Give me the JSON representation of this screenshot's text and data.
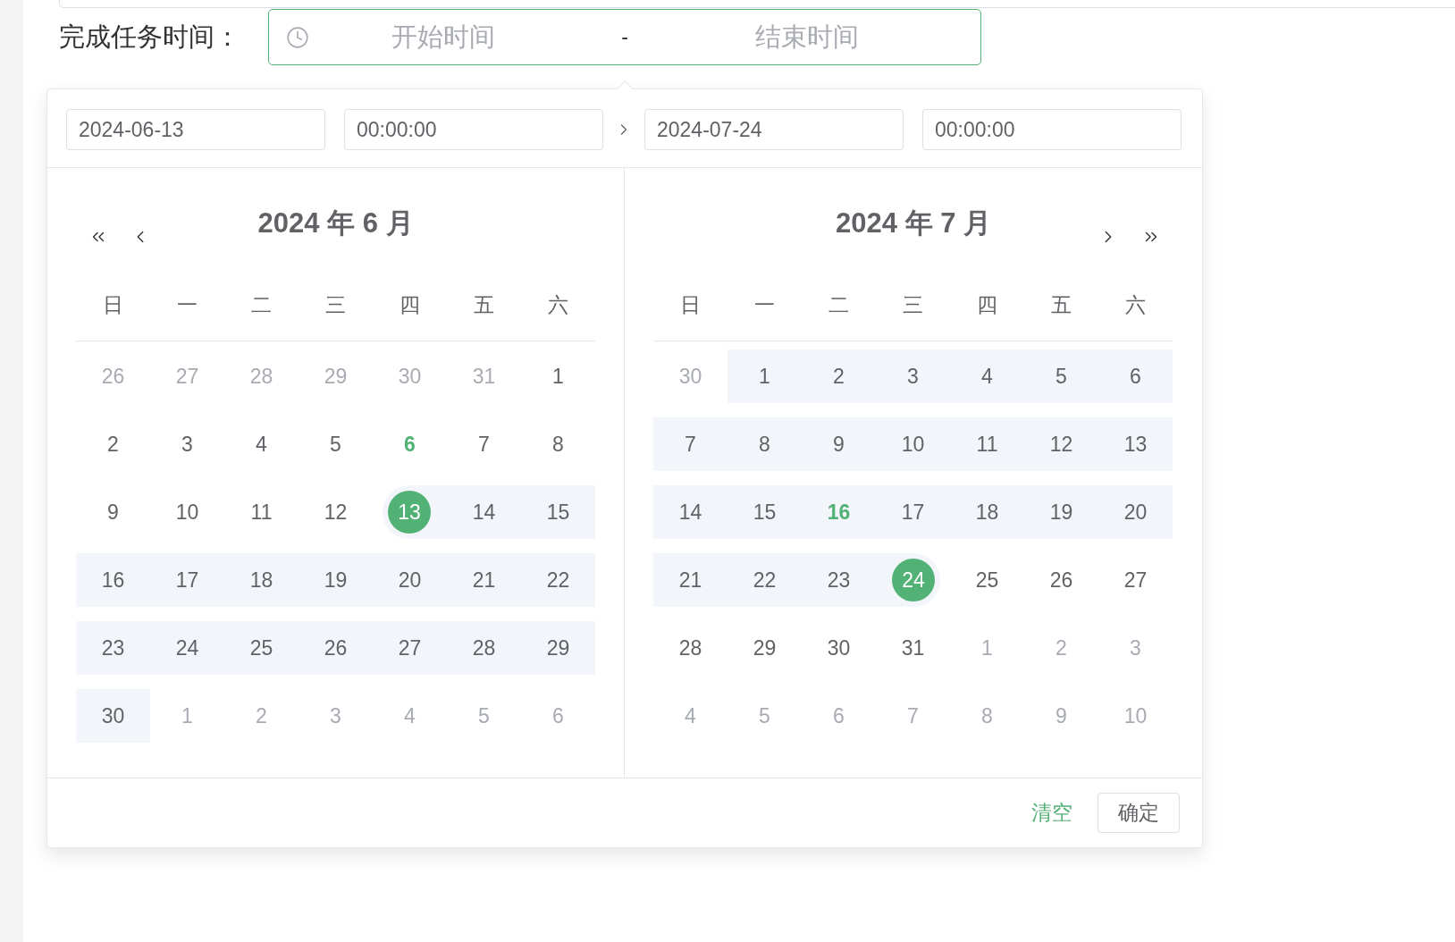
{
  "form": {
    "label": "完成任务时间：",
    "focused": true,
    "start_placeholder": "开始时间",
    "separator": "-",
    "end_placeholder": "结束时间"
  },
  "picker": {
    "start": {
      "date": "2024-06-13",
      "time": "00:00:00"
    },
    "end": {
      "date": "2024-07-24",
      "time": "00:00:00"
    },
    "panels": [
      {
        "prev_nav": true,
        "next_nav": false,
        "title": "2024 年 6 月",
        "weekdays": [
          "日",
          "一",
          "二",
          "三",
          "四",
          "五",
          "六"
        ],
        "weeks": [
          {
            "days": [
              {
                "text": "26",
                "kind": "adjacent",
                "today": false,
                "in_range": false,
                "selected": false
              },
              {
                "text": "27",
                "kind": "adjacent",
                "today": false,
                "in_range": false,
                "selected": false
              },
              {
                "text": "28",
                "kind": "adjacent",
                "today": false,
                "in_range": false,
                "selected": false
              },
              {
                "text": "29",
                "kind": "adjacent",
                "today": false,
                "in_range": false,
                "selected": false
              },
              {
                "text": "30",
                "kind": "adjacent",
                "today": false,
                "in_range": false,
                "selected": false
              },
              {
                "text": "31",
                "kind": "adjacent",
                "today": false,
                "in_range": false,
                "selected": false
              },
              {
                "text": "1",
                "kind": "current",
                "today": false,
                "in_range": false,
                "selected": false
              }
            ]
          },
          {
            "days": [
              {
                "text": "2",
                "kind": "current",
                "today": false,
                "in_range": false,
                "selected": false
              },
              {
                "text": "3",
                "kind": "current",
                "today": false,
                "in_range": false,
                "selected": false
              },
              {
                "text": "4",
                "kind": "current",
                "today": false,
                "in_range": false,
                "selected": false
              },
              {
                "text": "5",
                "kind": "current",
                "today": false,
                "in_range": false,
                "selected": false
              },
              {
                "text": "6",
                "kind": "current",
                "today": true,
                "in_range": false,
                "selected": false
              },
              {
                "text": "7",
                "kind": "current",
                "today": false,
                "in_range": false,
                "selected": false
              },
              {
                "text": "8",
                "kind": "current",
                "today": false,
                "in_range": false,
                "selected": false
              }
            ]
          },
          {
            "days": [
              {
                "text": "9",
                "kind": "current",
                "today": false,
                "in_range": false,
                "selected": false
              },
              {
                "text": "10",
                "kind": "current",
                "today": false,
                "in_range": false,
                "selected": false
              },
              {
                "text": "11",
                "kind": "current",
                "today": false,
                "in_range": false,
                "selected": false
              },
              {
                "text": "12",
                "kind": "current",
                "today": false,
                "in_range": false,
                "selected": false
              },
              {
                "text": "13",
                "kind": "current",
                "today": false,
                "in_range": true,
                "selected": true
              },
              {
                "text": "14",
                "kind": "current",
                "today": false,
                "in_range": true,
                "selected": false
              },
              {
                "text": "15",
                "kind": "current",
                "today": false,
                "in_range": true,
                "selected": false
              }
            ]
          },
          {
            "days": [
              {
                "text": "16",
                "kind": "current",
                "today": false,
                "in_range": true,
                "selected": false
              },
              {
                "text": "17",
                "kind": "current",
                "today": false,
                "in_range": true,
                "selected": false
              },
              {
                "text": "18",
                "kind": "current",
                "today": false,
                "in_range": true,
                "selected": false
              },
              {
                "text": "19",
                "kind": "current",
                "today": false,
                "in_range": true,
                "selected": false
              },
              {
                "text": "20",
                "kind": "current",
                "today": false,
                "in_range": true,
                "selected": false
              },
              {
                "text": "21",
                "kind": "current",
                "today": false,
                "in_range": true,
                "selected": false
              },
              {
                "text": "22",
                "kind": "current",
                "today": false,
                "in_range": true,
                "selected": false
              }
            ]
          },
          {
            "days": [
              {
                "text": "23",
                "kind": "current",
                "today": false,
                "in_range": true,
                "selected": false
              },
              {
                "text": "24",
                "kind": "current",
                "today": false,
                "in_range": true,
                "selected": false
              },
              {
                "text": "25",
                "kind": "current",
                "today": false,
                "in_range": true,
                "selected": false
              },
              {
                "text": "26",
                "kind": "current",
                "today": false,
                "in_range": true,
                "selected": false
              },
              {
                "text": "27",
                "kind": "current",
                "today": false,
                "in_range": true,
                "selected": false
              },
              {
                "text": "28",
                "kind": "current",
                "today": false,
                "in_range": true,
                "selected": false
              },
              {
                "text": "29",
                "kind": "current",
                "today": false,
                "in_range": true,
                "selected": false
              }
            ]
          },
          {
            "days": [
              {
                "text": "30",
                "kind": "current",
                "today": false,
                "in_range": true,
                "selected": false
              },
              {
                "text": "1",
                "kind": "adjacent",
                "today": false,
                "in_range": false,
                "selected": false
              },
              {
                "text": "2",
                "kind": "adjacent",
                "today": false,
                "in_range": false,
                "selected": false
              },
              {
                "text": "3",
                "kind": "adjacent",
                "today": false,
                "in_range": false,
                "selected": false
              },
              {
                "text": "4",
                "kind": "adjacent",
                "today": false,
                "in_range": false,
                "selected": false
              },
              {
                "text": "5",
                "kind": "adjacent",
                "today": false,
                "in_range": false,
                "selected": false
              },
              {
                "text": "6",
                "kind": "adjacent",
                "today": false,
                "in_range": false,
                "selected": false
              }
            ]
          }
        ]
      },
      {
        "prev_nav": false,
        "next_nav": true,
        "title": "2024 年 7 月",
        "weekdays": [
          "日",
          "一",
          "二",
          "三",
          "四",
          "五",
          "六"
        ],
        "weeks": [
          {
            "days": [
              {
                "text": "30",
                "kind": "adjacent",
                "today": false,
                "in_range": false,
                "selected": false
              },
              {
                "text": "1",
                "kind": "current",
                "today": false,
                "in_range": true,
                "selected": false
              },
              {
                "text": "2",
                "kind": "current",
                "today": false,
                "in_range": true,
                "selected": false
              },
              {
                "text": "3",
                "kind": "current",
                "today": false,
                "in_range": true,
                "selected": false
              },
              {
                "text": "4",
                "kind": "current",
                "today": false,
                "in_range": true,
                "selected": false
              },
              {
                "text": "5",
                "kind": "current",
                "today": false,
                "in_range": true,
                "selected": false
              },
              {
                "text": "6",
                "kind": "current",
                "today": false,
                "in_range": true,
                "selected": false
              }
            ]
          },
          {
            "days": [
              {
                "text": "7",
                "kind": "current",
                "today": false,
                "in_range": true,
                "selected": false
              },
              {
                "text": "8",
                "kind": "current",
                "today": false,
                "in_range": true,
                "selected": false
              },
              {
                "text": "9",
                "kind": "current",
                "today": false,
                "in_range": true,
                "selected": false
              },
              {
                "text": "10",
                "kind": "current",
                "today": false,
                "in_range": true,
                "selected": false
              },
              {
                "text": "11",
                "kind": "current",
                "today": false,
                "in_range": true,
                "selected": false
              },
              {
                "text": "12",
                "kind": "current",
                "today": false,
                "in_range": true,
                "selected": false
              },
              {
                "text": "13",
                "kind": "current",
                "today": false,
                "in_range": true,
                "selected": false
              }
            ]
          },
          {
            "days": [
              {
                "text": "14",
                "kind": "current",
                "today": false,
                "in_range": true,
                "selected": false
              },
              {
                "text": "15",
                "kind": "current",
                "today": false,
                "in_range": true,
                "selected": false
              },
              {
                "text": "16",
                "kind": "current",
                "today": true,
                "in_range": true,
                "selected": false
              },
              {
                "text": "17",
                "kind": "current",
                "today": false,
                "in_range": true,
                "selected": false
              },
              {
                "text": "18",
                "kind": "current",
                "today": false,
                "in_range": true,
                "selected": false
              },
              {
                "text": "19",
                "kind": "current",
                "today": false,
                "in_range": true,
                "selected": false
              },
              {
                "text": "20",
                "kind": "current",
                "today": false,
                "in_range": true,
                "selected": false
              }
            ]
          },
          {
            "days": [
              {
                "text": "21",
                "kind": "current",
                "today": false,
                "in_range": true,
                "selected": false
              },
              {
                "text": "22",
                "kind": "current",
                "today": false,
                "in_range": true,
                "selected": false
              },
              {
                "text": "23",
                "kind": "current",
                "today": false,
                "in_range": true,
                "selected": false
              },
              {
                "text": "24",
                "kind": "current",
                "today": false,
                "in_range": true,
                "selected": true
              },
              {
                "text": "25",
                "kind": "current",
                "today": false,
                "in_range": false,
                "selected": false
              },
              {
                "text": "26",
                "kind": "current",
                "today": false,
                "in_range": false,
                "selected": false
              },
              {
                "text": "27",
                "kind": "current",
                "today": false,
                "in_range": false,
                "selected": false
              }
            ]
          },
          {
            "days": [
              {
                "text": "28",
                "kind": "current",
                "today": false,
                "in_range": false,
                "selected": false
              },
              {
                "text": "29",
                "kind": "current",
                "today": false,
                "in_range": false,
                "selected": false
              },
              {
                "text": "30",
                "kind": "current",
                "today": false,
                "in_range": false,
                "selected": false
              },
              {
                "text": "31",
                "kind": "current",
                "today": false,
                "in_range": false,
                "selected": false
              },
              {
                "text": "1",
                "kind": "adjacent",
                "today": false,
                "in_range": false,
                "selected": false
              },
              {
                "text": "2",
                "kind": "adjacent",
                "today": false,
                "in_range": false,
                "selected": false
              },
              {
                "text": "3",
                "kind": "adjacent",
                "today": false,
                "in_range": false,
                "selected": false
              }
            ]
          },
          {
            "days": [
              {
                "text": "4",
                "kind": "adjacent",
                "today": false,
                "in_range": false,
                "selected": false
              },
              {
                "text": "5",
                "kind": "adjacent",
                "today": false,
                "in_range": false,
                "selected": false
              },
              {
                "text": "6",
                "kind": "adjacent",
                "today": false,
                "in_range": false,
                "selected": false
              },
              {
                "text": "7",
                "kind": "adjacent",
                "today": false,
                "in_range": false,
                "selected": false
              },
              {
                "text": "8",
                "kind": "adjacent",
                "today": false,
                "in_range": false,
                "selected": false
              },
              {
                "text": "9",
                "kind": "adjacent",
                "today": false,
                "in_range": false,
                "selected": false
              },
              {
                "text": "10",
                "kind": "adjacent",
                "today": false,
                "in_range": false,
                "selected": false
              }
            ]
          }
        ]
      }
    ],
    "footer": {
      "clear": "清空",
      "confirm": "确定"
    }
  }
}
